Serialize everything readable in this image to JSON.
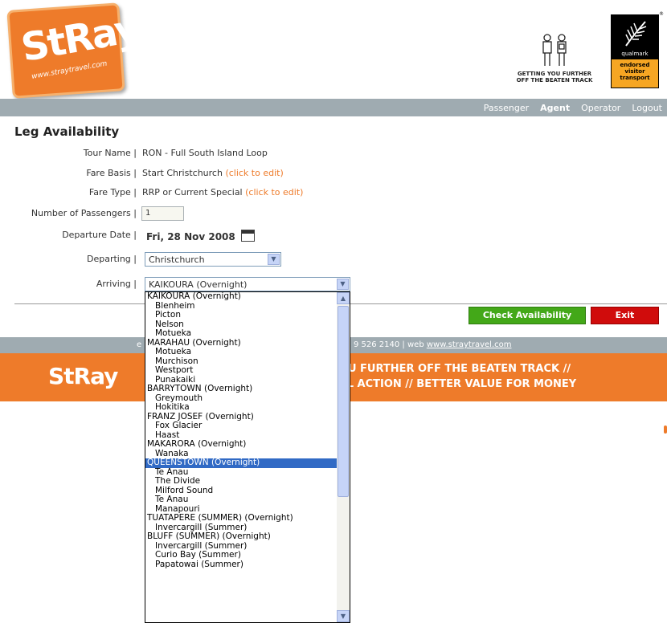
{
  "header": {
    "logo_word": "StRay",
    "logo_url": "www.straytravel.com",
    "tagline_line1": "GETTING YOU FURTHER",
    "tagline_line2": "OFF THE BEATEN TRACK",
    "qualmark": "qualmark",
    "qualmark_line1": "endorsed",
    "qualmark_line2": "visitor",
    "qualmark_line3": "transport",
    "reg_mark": "®"
  },
  "nav": [
    "Passenger",
    "Agent",
    "Operator",
    "Logout"
  ],
  "page_title": "Leg Availability",
  "fields": {
    "tour_name_label": "Tour Name |",
    "tour_name_value": "RON - Full South Island Loop",
    "fare_basis_label": "Fare Basis |",
    "fare_basis_value": "Start Christchurch",
    "fare_type_label": "Fare Type |",
    "fare_type_value": "RRP or Current Special",
    "edit_link": "(click to edit)",
    "passengers_label": "Number of Passengers |",
    "passengers_value": "1",
    "departure_date_label": "Departure Date |",
    "departure_date_value": "Fri, 28 Nov 2008",
    "departing_label": "Departing |",
    "departing_value": "Christchurch",
    "arriving_label": "Arriving |",
    "arriving_value": "KAIKOURA (Overnight)"
  },
  "buttons": {
    "check": "Check Availability",
    "exit": "Exit"
  },
  "footer": {
    "contact_prefix": "e",
    "contact_phone": "9 526 2140 | web ",
    "contact_web": "www.straytravel.com",
    "logo": "StRay",
    "slogan_line1": "GET YOU FURTHER OFF THE BEATEN TRACK //",
    "slogan_line2": "ST REAL ACTION // BETTER VALUE FOR MONEY"
  },
  "dropdown": {
    "selected_index": 21,
    "items": [
      {
        "label": "KAIKOURA (Overnight)",
        "indent": false
      },
      {
        "label": "Blenheim",
        "indent": true
      },
      {
        "label": "Picton",
        "indent": true
      },
      {
        "label": "Nelson",
        "indent": true
      },
      {
        "label": "Motueka",
        "indent": true
      },
      {
        "label": "MARAHAU (Overnight)",
        "indent": false
      },
      {
        "label": "Motueka",
        "indent": true
      },
      {
        "label": "Murchison",
        "indent": true
      },
      {
        "label": "Westport",
        "indent": true
      },
      {
        "label": "Punakaiki",
        "indent": true
      },
      {
        "label": "BARRYTOWN (Overnight)",
        "indent": false
      },
      {
        "label": "Greymouth",
        "indent": true
      },
      {
        "label": "Hokitika",
        "indent": true
      },
      {
        "label": "FRANZ JOSEF (Overnight)",
        "indent": false
      },
      {
        "label": "Fox Glacier",
        "indent": true
      },
      {
        "label": "Haast",
        "indent": true
      },
      {
        "label": "MAKARORA (Overnight)",
        "indent": false
      },
      {
        "label": "Wanaka",
        "indent": true
      },
      {
        "label": "QUEENSTOWN (Overnight)",
        "indent": false
      },
      {
        "label": "Te Anau",
        "indent": true
      },
      {
        "label": "The Divide",
        "indent": true
      },
      {
        "label": "Milford Sound",
        "indent": true
      },
      {
        "label": "Te Anau",
        "indent": true
      },
      {
        "label": "Manapouri",
        "indent": true
      },
      {
        "label": "TUATAPERE (SUMMER) (Overnight)",
        "indent": false
      },
      {
        "label": "Invercargill (Summer)",
        "indent": true
      },
      {
        "label": "BLUFF (SUMMER) (Overnight)",
        "indent": false
      },
      {
        "label": "Invercargill (Summer)",
        "indent": true
      },
      {
        "label": "Curio Bay (Summer)",
        "indent": true
      },
      {
        "label": "Papatowai (Summer)",
        "indent": true
      }
    ]
  }
}
